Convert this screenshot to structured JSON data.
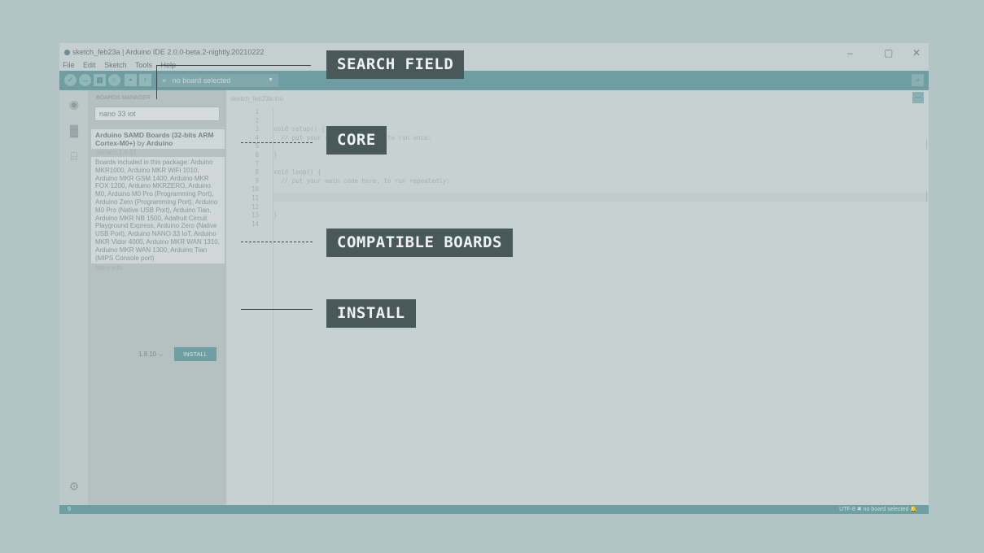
{
  "window": {
    "title": "sketch_feb23a | Arduino IDE 2.0.0-beta.2-nightly.20210222",
    "controls": [
      "–",
      "▢",
      "✕"
    ]
  },
  "menu": [
    "File",
    "Edit",
    "Sketch",
    "Tools",
    "Help"
  ],
  "toolbar": {
    "board_selector": "no board selected",
    "board_close": "×"
  },
  "boards_manager": {
    "title": "BOARDS MANAGER",
    "search_value": "nano 33 iot",
    "core": {
      "title": "Arduino SAMD Boards (32-bits ARM Cortex-M0+)",
      "by_label": "by",
      "author": "Arduino",
      "version": "Version 1.8.11",
      "description": "Boards included in this package: Arduino MKR1000, Arduino MKR WiFi 1010, Arduino MKR GSM 1400, Arduino MKR FOX 1200, Arduino MKRZERO, Arduino M0, Arduino M0 Pro (Programming Port), Arduino Zero (Programming Port), Arduino M0 Pro (Native USB Port), Arduino Tian, Arduino MKR NB 1500, Adafruit Circuit Playground Express, Arduino Zero (Native USB Port), Arduino NANO 33 IoT, Arduino MKR Vidor 4000, Arduino MKR WAN 1310, Arduino MKR WAN 1300, Arduino Tian (MIPS Console port)",
      "more_info": "More info",
      "selected_version": "1.8.10",
      "install_label": "INSTALL"
    }
  },
  "editor": {
    "tab": "sketch_feb23a.ino",
    "line_numbers": [
      "1",
      "2",
      "3",
      "4",
      "5",
      "6",
      "7",
      "8",
      "9",
      "10",
      "11",
      "12",
      "13",
      "14"
    ],
    "code_lines": [
      "",
      "",
      "void setup() {",
      "  // put your setup code here, to run once:",
      "",
      "}",
      "",
      "void loop() {",
      "  // put your main code here, to run repeatedly:",
      "",
      "",
      "",
      "}",
      ""
    ]
  },
  "statusbar": {
    "left": "9",
    "right": "UTF-8   ✖ no board selected   🔔"
  },
  "callouts": {
    "search_field": "SEARCH FIELD",
    "core": "CORE",
    "compatible_boards": "COMPATIBLE BOARDS",
    "install": "INSTALL"
  }
}
